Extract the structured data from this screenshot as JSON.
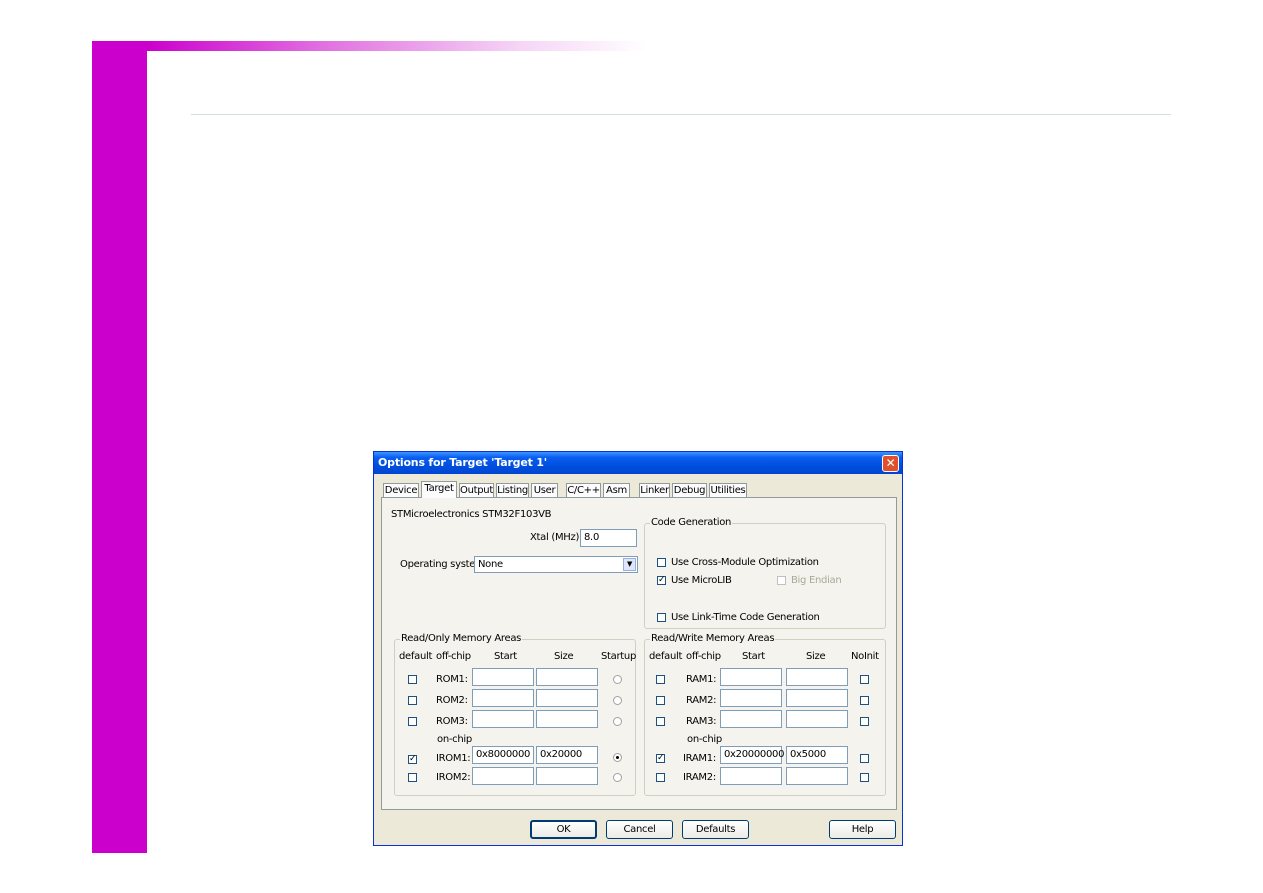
{
  "dialog": {
    "title": "Options for Target 'Target 1'",
    "close_glyph": "✕"
  },
  "tabs": [
    "Device",
    "Target",
    "Output",
    "Listing",
    "User",
    "C/C++",
    "Asm",
    "Linker",
    "Debug",
    "Utilities"
  ],
  "active_tab": "Target",
  "target": {
    "device_name": "STMicroelectronics STM32F103VB",
    "xtal_label": "Xtal (MHz):",
    "xtal_value": "8.0",
    "os_label": "Operating system:",
    "os_value": "None"
  },
  "code_generation": {
    "title": "Code Generation",
    "cross_module": {
      "label": "Use Cross-Module Optimization",
      "checked": false
    },
    "microlib": {
      "label": "Use MicroLIB",
      "checked": true
    },
    "big_endian": {
      "label": "Big Endian",
      "checked": false,
      "enabled": false
    },
    "link_time": {
      "label": "Use Link-Time Code Generation",
      "checked": false
    }
  },
  "rom_areas": {
    "title": "Read/Only Memory Areas",
    "headers": {
      "default": "default",
      "offchip": "off-chip",
      "start": "Start",
      "size": "Size",
      "extra": "Startup"
    },
    "onchip_label": "on-chip",
    "rows": [
      {
        "label": "ROM1:",
        "default": false,
        "start": "",
        "size": "",
        "startup": false
      },
      {
        "label": "ROM2:",
        "default": false,
        "start": "",
        "size": "",
        "startup": false
      },
      {
        "label": "ROM3:",
        "default": false,
        "start": "",
        "size": "",
        "startup": false
      },
      {
        "label": "IROM1:",
        "default": true,
        "start": "0x8000000",
        "size": "0x20000",
        "startup": true
      },
      {
        "label": "IROM2:",
        "default": false,
        "start": "",
        "size": "",
        "startup": false
      }
    ]
  },
  "ram_areas": {
    "title": "Read/Write Memory Areas",
    "headers": {
      "default": "default",
      "offchip": "off-chip",
      "start": "Start",
      "size": "Size",
      "extra": "NoInit"
    },
    "onchip_label": "on-chip",
    "rows": [
      {
        "label": "RAM1:",
        "default": false,
        "start": "",
        "size": "",
        "noinit": false
      },
      {
        "label": "RAM2:",
        "default": false,
        "start": "",
        "size": "",
        "noinit": false
      },
      {
        "label": "RAM3:",
        "default": false,
        "start": "",
        "size": "",
        "noinit": false
      },
      {
        "label": "IRAM1:",
        "default": true,
        "start": "0x20000000",
        "size": "0x5000",
        "noinit": false
      },
      {
        "label": "IRAM2:",
        "default": false,
        "start": "",
        "size": "",
        "noinit": false
      }
    ]
  },
  "buttons": {
    "ok": "OK",
    "cancel": "Cancel",
    "defaults": "Defaults",
    "help": "Help"
  },
  "check_glyph": "✓"
}
